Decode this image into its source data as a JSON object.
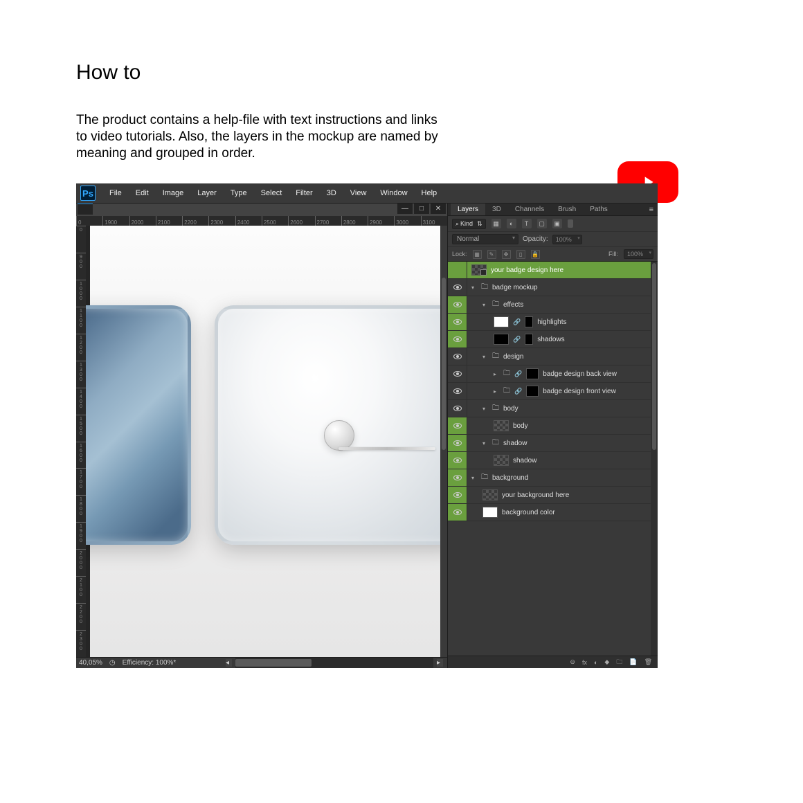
{
  "heading": {
    "title": "How to",
    "description": "The product contains a help-file with text instructions and links to video tutorials. Also, the layers in the mockup are named by meaning and grouped in order."
  },
  "menubar": [
    "File",
    "Edit",
    "Image",
    "Layer",
    "Type",
    "Select",
    "Filter",
    "3D",
    "View",
    "Window",
    "Help"
  ],
  "ruler_h": [
    "0",
    "1900",
    "2000",
    "2100",
    "2200",
    "2300",
    "2400",
    "2500",
    "2600",
    "2700",
    "2800",
    "2900",
    "3000",
    "3100"
  ],
  "ruler_v": [
    "0",
    "900",
    "1000",
    "1100",
    "1200",
    "1300",
    "1400",
    "1500",
    "1600",
    "1700",
    "1800",
    "1900",
    "2000",
    "2100",
    "2200",
    "2300"
  ],
  "status": {
    "zoom": "40,05%",
    "efficiency": "Efficiency: 100%*"
  },
  "panel_tabs": [
    "Layers",
    "3D",
    "Channels",
    "Brush",
    "Paths"
  ],
  "filter": {
    "kind": "Kind"
  },
  "blend": {
    "mode": "Normal",
    "opacity_label": "Opacity:",
    "opacity": "100%"
  },
  "lock": {
    "label": "Lock:",
    "fill_label": "Fill:",
    "fill": "100%"
  },
  "layers": [
    {
      "name": "your badge design here",
      "indent": 0,
      "type": "smart",
      "selected": true,
      "eye": false
    },
    {
      "name": "badge mockup",
      "indent": 0,
      "type": "folder_open"
    },
    {
      "name": "effects",
      "indent": 1,
      "type": "folder_open",
      "selbox": true
    },
    {
      "name": "highlights",
      "indent": 2,
      "type": "layer_with_mask",
      "swatch": "white",
      "selbox": true
    },
    {
      "name": "shadows",
      "indent": 2,
      "type": "layer_with_mask",
      "swatch": "black",
      "selbox": true
    },
    {
      "name": "design",
      "indent": 1,
      "type": "folder_open"
    },
    {
      "name": "badge design back view",
      "indent": 2,
      "type": "smart_with_mask_closed"
    },
    {
      "name": "badge design front view",
      "indent": 2,
      "type": "smart_with_mask_closed"
    },
    {
      "name": "body",
      "indent": 1,
      "type": "folder_open"
    },
    {
      "name": "body",
      "indent": 2,
      "type": "smart_checker",
      "selbox": true
    },
    {
      "name": "shadow",
      "indent": 1,
      "type": "folder_open",
      "selbox": true
    },
    {
      "name": "shadow",
      "indent": 2,
      "type": "layer_checker",
      "selbox": true
    },
    {
      "name": "background",
      "indent": 0,
      "type": "folder_open",
      "selbox": true
    },
    {
      "name": "your background here",
      "indent": 1,
      "type": "layer_checker",
      "selbox": true
    },
    {
      "name": "background color",
      "indent": 1,
      "type": "layer_white",
      "selbox": true
    }
  ],
  "footer_icons": [
    "⊖",
    "fx",
    "◐",
    "◆",
    "🗀",
    "📄",
    "🗑"
  ]
}
